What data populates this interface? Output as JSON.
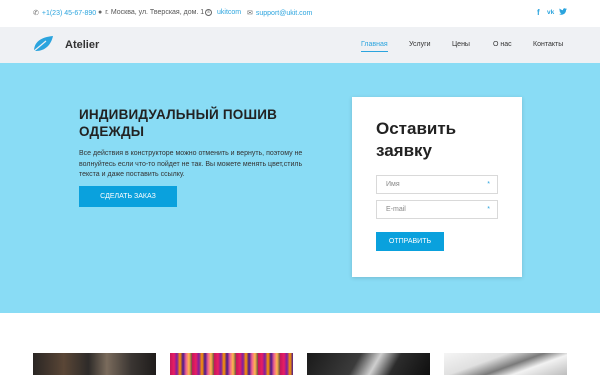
{
  "topbar": {
    "phone": "+1(23) 45-67-890",
    "address": "г. Москва, ул. Тверская, дом. 1",
    "skype": "ukitcom",
    "email": "support@ukit.com",
    "social": [
      "f",
      "vk",
      "tw"
    ]
  },
  "header": {
    "brand": "Atelier",
    "nav": [
      "Главная",
      "Услуги",
      "Цены",
      "О нас",
      "Контакты"
    ]
  },
  "hero": {
    "title": "ИНДИВИДУАЛЬНЫЙ ПОШИВ ОДЕЖДЫ",
    "text": "Все действия в конструкторе можно отменить и вернуть, поэтому не волнуйтесь если что-то пойдет не так. Вы можете менять цвет,стиль текста и даже поставить ссылку.",
    "button": "СДЕЛАТЬ ЗАКАЗ"
  },
  "form": {
    "title": "Оставить заявку",
    "name_placeholder": "Имя",
    "email_placeholder": "E-mail",
    "required_mark": "*",
    "submit": "ОТПРАВИТЬ"
  },
  "gallery": [
    "image-1",
    "image-2",
    "image-3",
    "image-4"
  ],
  "colors": {
    "accent": "#0aa1dd",
    "hero_bg": "#89dcf5",
    "header_bg": "#eff1f4"
  }
}
